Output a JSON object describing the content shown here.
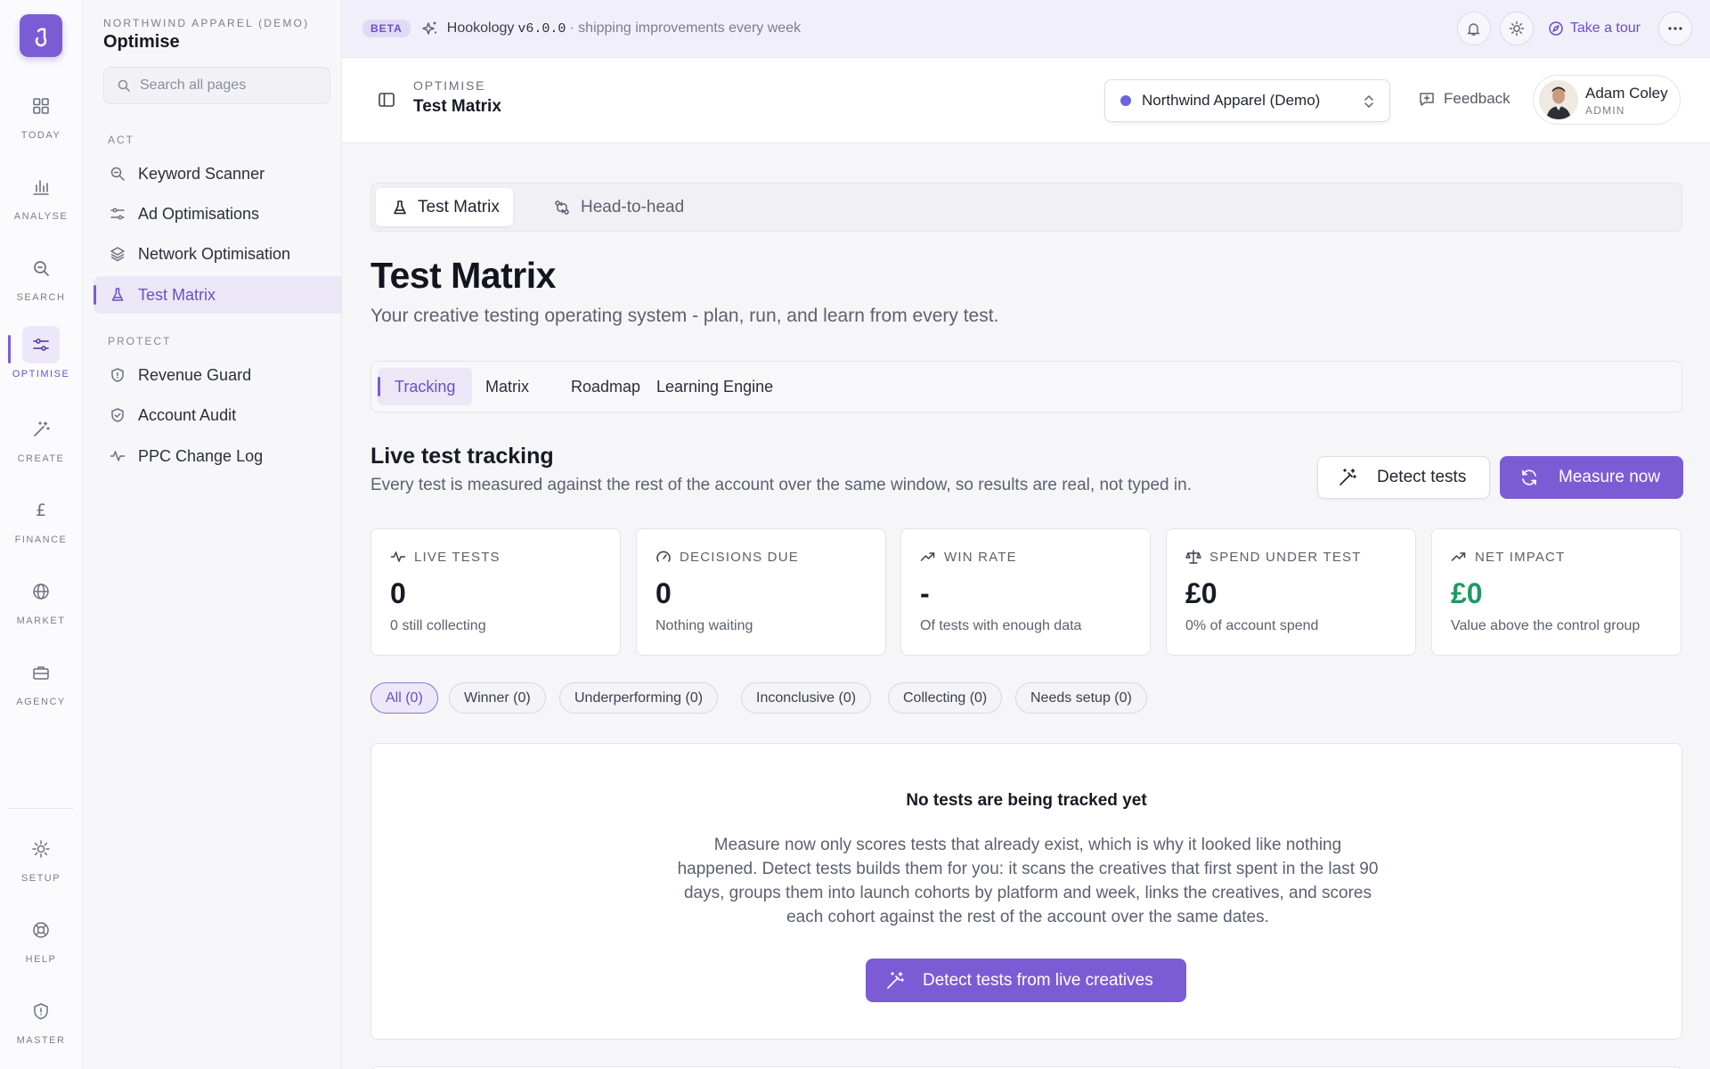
{
  "rail": {
    "items": [
      {
        "label": "Today",
        "icon": "grid-icon"
      },
      {
        "label": "Analyse",
        "icon": "bar-chart-icon"
      },
      {
        "label": "Search",
        "icon": "search-icon"
      },
      {
        "label": "Optimise",
        "icon": "sliders-icon"
      },
      {
        "label": "Create",
        "icon": "magic-wand-icon"
      },
      {
        "label": "Finance",
        "icon": "pound-icon"
      },
      {
        "label": "Market",
        "icon": "globe-icon"
      },
      {
        "label": "Agency",
        "icon": "briefcase-icon"
      }
    ],
    "bottom": [
      {
        "label": "Setup",
        "icon": "gear-icon"
      },
      {
        "label": "Help",
        "icon": "lifebuoy-icon"
      },
      {
        "label": "Master",
        "icon": "shield-icon"
      }
    ],
    "active": "Optimise"
  },
  "nav": {
    "workspace": "Northwind Apparel (Demo)",
    "title": "Optimise",
    "search_placeholder": "Search all pages",
    "sections": [
      {
        "label": "Act",
        "items": [
          {
            "label": "Keyword Scanner",
            "icon": "zoom-icon"
          },
          {
            "label": "Ad Optimisations",
            "icon": "sliders-icon"
          },
          {
            "label": "Network Optimisation",
            "icon": "layers-icon"
          },
          {
            "label": "Test Matrix",
            "icon": "flask-icon",
            "active": true
          }
        ]
      },
      {
        "label": "Protect",
        "items": [
          {
            "label": "Revenue Guard",
            "icon": "shield-icon"
          },
          {
            "label": "Account Audit",
            "icon": "shield-check-icon"
          },
          {
            "label": "PPC Change Log",
            "icon": "activity-icon"
          }
        ]
      }
    ]
  },
  "banner": {
    "badge": "BETA",
    "product": "Hookology",
    "version": "v6.0.0",
    "tagline": "· shipping improvements every week",
    "tour_label": "Take a tour"
  },
  "header": {
    "section": "Optimise",
    "page": "Test Matrix",
    "account": "Northwind Apparel (Demo)",
    "feedback": "Feedback",
    "user_name": "Adam Coley",
    "user_role": "ADMIN"
  },
  "main": {
    "top_tabs": [
      {
        "label": "Test Matrix",
        "icon": "flask-icon",
        "active": true
      },
      {
        "label": "Head-to-head",
        "icon": "git-compare-icon",
        "active": false
      }
    ],
    "title": "Test Matrix",
    "subtitle": "Your creative testing operating system - plan, run, and learn from every test.",
    "sub_tabs": [
      {
        "label": "Tracking",
        "active": true
      },
      {
        "label": "Matrix",
        "active": false
      },
      {
        "label": "Roadmap",
        "active": false
      },
      {
        "label": "Learning Engine",
        "active": false
      }
    ],
    "section_title": "Live test tracking",
    "section_desc": "Every test is measured against the rest of the account over the same window, so results are real, not typed in.",
    "detect_label": "Detect tests",
    "measure_label": "Measure now",
    "stats": [
      {
        "label": "Live tests",
        "value": "0",
        "sub": "0 still collecting",
        "icon": "activity-icon"
      },
      {
        "label": "Decisions due",
        "value": "0",
        "sub": "Nothing waiting",
        "icon": "gauge-icon"
      },
      {
        "label": "Win rate",
        "value": "-",
        "sub": "Of tests with enough data",
        "icon": "trending-up-icon"
      },
      {
        "label": "Spend under test",
        "value": "£0",
        "sub": "0% of account spend",
        "icon": "scale-icon"
      },
      {
        "label": "Net impact",
        "value": "£0",
        "sub": "Value above the control group",
        "icon": "trending-up-icon",
        "positive": true
      }
    ],
    "filters": [
      {
        "label": "All (0)",
        "active": true
      },
      {
        "label": "Winner (0)"
      },
      {
        "label": "Underperforming (0)"
      },
      {
        "label": "Inconclusive (0)"
      },
      {
        "label": "Collecting (0)"
      },
      {
        "label": "Needs setup (0)"
      }
    ],
    "empty": {
      "title": "No tests are being tracked yet",
      "body": "Measure now only scores tests that already exist, which is why it looked like nothing happened. Detect tests builds them for you: it scans the creatives that first spent in the last 90 days, groups them into launch cohorts by platform and week, links the creatives, and scores each cohort against the rest of the account over the same dates.",
      "button": "Detect tests from live creatives"
    }
  },
  "colors": {
    "accent": "#7c5cd4",
    "positive": "#1c9a63"
  }
}
